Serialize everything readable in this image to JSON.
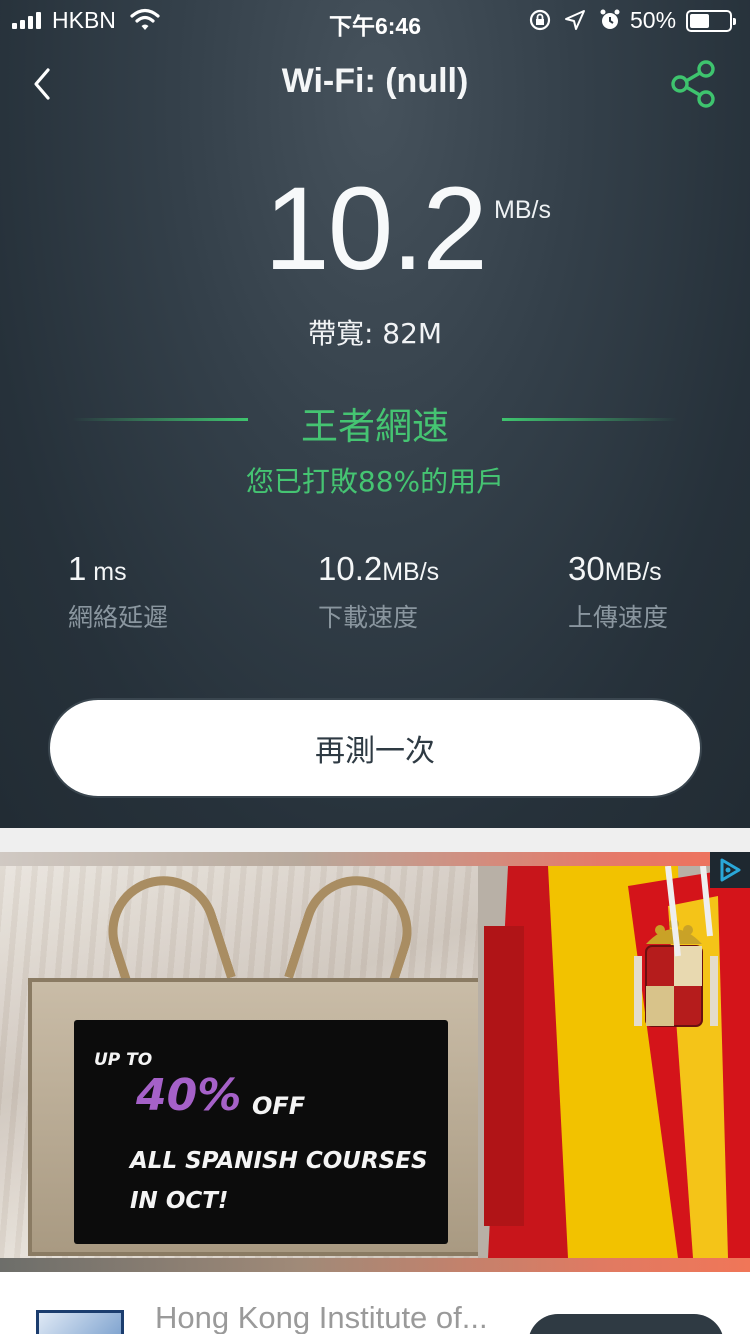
{
  "status_bar": {
    "carrier": "HKBN",
    "time": "下午6:46",
    "battery_percent": "50%",
    "battery_level": 0.5,
    "icons": [
      "signal-icon",
      "wifi-icon",
      "orientation-lock-icon",
      "location-icon",
      "alarm-icon",
      "battery-icon"
    ]
  },
  "nav": {
    "title": "Wi-Fi: (null)",
    "back_icon": "chevron-left-icon",
    "share_icon": "share-icon"
  },
  "result": {
    "speed": "10.2",
    "speed_unit": "MB/s",
    "bandwidth": "帶寬: 82M",
    "rank_title": "王者網速",
    "rank_subtitle": "您已打敗88%的用戶"
  },
  "stats": [
    {
      "value": "1",
      "unit": " ms",
      "label": "網絡延遲"
    },
    {
      "value": "10.2",
      "unit": "MB/s",
      "label": "下載速度"
    },
    {
      "value": "30",
      "unit": "MB/s",
      "label": "上傳速度"
    }
  ],
  "retest_label": "再測一次",
  "ad": {
    "chalk_line_1": "UP TO",
    "chalk_line_2": "40%",
    "chalk_line_2b": "OFF",
    "chalk_line_3": "ALL SPANISH COURSES",
    "chalk_line_4": "IN OCT!",
    "advertiser": "Hong Kong Institute of...",
    "badge_icon": "adchoices-icon",
    "colors": {
      "accent_green": "#45c472",
      "dark_bg": "#2b3640",
      "chalk_purple": "#a561c8"
    }
  }
}
